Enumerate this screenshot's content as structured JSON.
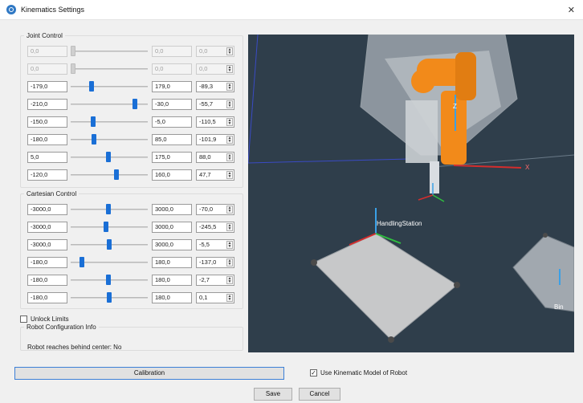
{
  "window": {
    "title": "Kinematics Settings"
  },
  "joint_control": {
    "title": "Joint Control",
    "rows": [
      {
        "min": "0,0",
        "max": "0,0",
        "value": "0,0",
        "position": 0.0,
        "enabled": false
      },
      {
        "min": "0,0",
        "max": "0,0",
        "value": "0,0",
        "position": 0.0,
        "enabled": false
      },
      {
        "min": "-179,0",
        "max": "179,0",
        "value": "-89,3",
        "position": 0.25,
        "enabled": true
      },
      {
        "min": "-210,0",
        "max": "-30,0",
        "value": "-55,7",
        "position": 0.86,
        "enabled": true
      },
      {
        "min": "-150,0",
        "max": "-5,0",
        "value": "-110,5",
        "position": 0.28,
        "enabled": true
      },
      {
        "min": "-180,0",
        "max": "85,0",
        "value": "-101,9",
        "position": 0.29,
        "enabled": true
      },
      {
        "min": "5,0",
        "max": "175,0",
        "value": "88,0",
        "position": 0.49,
        "enabled": true
      },
      {
        "min": "-120,0",
        "max": "160,0",
        "value": "47,7",
        "position": 0.6,
        "enabled": true
      }
    ]
  },
  "cartesian_control": {
    "title": "Cartesian Control",
    "rows": [
      {
        "min": "-3000,0",
        "max": "3000,0",
        "value": "-70,0",
        "position": 0.49
      },
      {
        "min": "-3000,0",
        "max": "3000,0",
        "value": "-245,5",
        "position": 0.46
      },
      {
        "min": "-3000,0",
        "max": "3000,0",
        "value": "-5,5",
        "position": 0.5
      },
      {
        "min": "-180,0",
        "max": "180,0",
        "value": "-137,0",
        "position": 0.12
      },
      {
        "min": "-180,0",
        "max": "180,0",
        "value": "-2,7",
        "position": 0.49
      },
      {
        "min": "-180,0",
        "max": "180,0",
        "value": "0,1",
        "position": 0.5
      }
    ]
  },
  "unlock_limits": {
    "label": "Unlock Limits",
    "checked": false
  },
  "robot_info": {
    "title": "Robot Configuration Info",
    "text": "Robot reaches behind center: No"
  },
  "viewport": {
    "handling_station_label": "HandlingStation",
    "bin_label": "Bin",
    "axis_x": "X",
    "axis_z": "Z"
  },
  "buttons": {
    "calibration": "Calibration",
    "save": "Save",
    "cancel": "Cancel"
  },
  "use_kinematic": {
    "label": "Use Kinematic Model of Robot",
    "checked": true
  },
  "icons": {
    "app": "app-logo-icon",
    "close": "close-icon",
    "spin": "spin-arrows-icon",
    "check": "checkmark-icon"
  },
  "colors": {
    "accent": "#1a6fd6",
    "viewport_bg": "#2f3e4b",
    "robot": "#f28a1a"
  }
}
